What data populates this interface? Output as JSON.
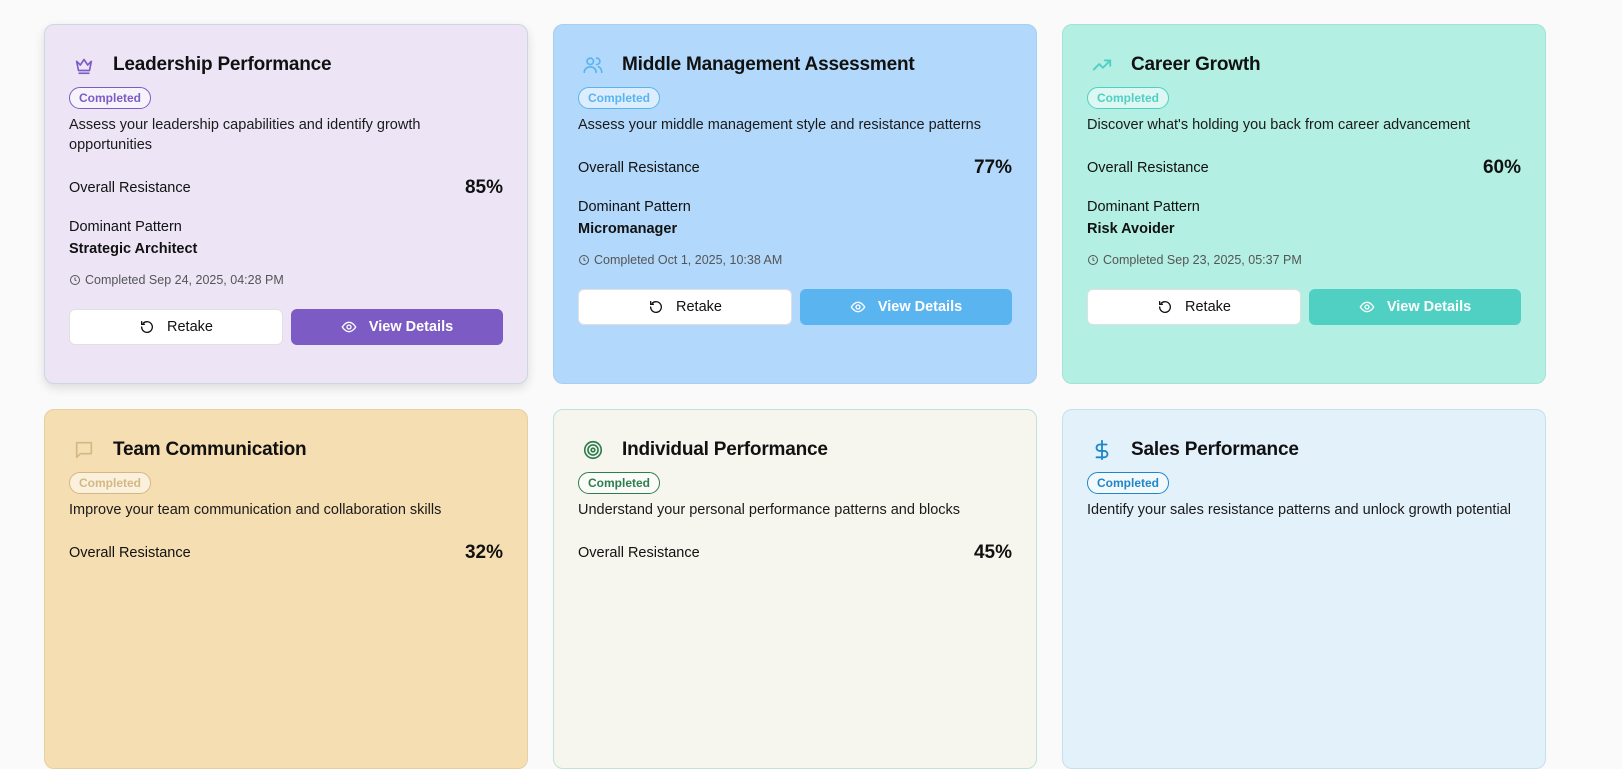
{
  "cards": [
    {
      "title": "Leadership Performance",
      "status": "Completed",
      "description": "Assess your leadership capabilities and identify growth opportunities",
      "resistance_label": "Overall Resistance",
      "resistance_value": "85%",
      "pattern_label": "Dominant Pattern",
      "pattern_value": "Strategic Architect",
      "completed_text": "Completed Sep 24, 2025, 04:28 PM",
      "retake_label": "Retake",
      "view_label": "View Details",
      "icon": "crown-icon",
      "colors": {
        "bg": "#ede5f6",
        "accent": "#7c5cc4",
        "border": "#ccd8df"
      }
    },
    {
      "title": "Middle Management Assessment",
      "status": "Completed",
      "description": "Assess your middle management style and resistance patterns",
      "resistance_label": "Overall Resistance",
      "resistance_value": "77%",
      "pattern_label": "Dominant Pattern",
      "pattern_value": "Micromanager",
      "completed_text": "Completed Oct 1, 2025, 10:38 AM",
      "retake_label": "Retake",
      "view_label": "View Details",
      "icon": "users-icon",
      "colors": {
        "bg": "#b2d8fb",
        "accent": "#5ab4f0",
        "border": "#a8cfee"
      }
    },
    {
      "title": "Career Growth",
      "status": "Completed",
      "description": "Discover what's holding you back from career advancement",
      "resistance_label": "Overall Resistance",
      "resistance_value": "60%",
      "pattern_label": "Dominant Pattern",
      "pattern_value": "Risk Avoider",
      "completed_text": "Completed Sep 23, 2025, 05:37 PM",
      "retake_label": "Retake",
      "view_label": "View Details",
      "icon": "trending-up-icon",
      "colors": {
        "bg": "#b3efe2",
        "accent": "#4fd0c2",
        "border": "#a4e2d6"
      }
    },
    {
      "title": "Team Communication",
      "status": "Completed",
      "description": "Improve your team communication and collaboration skills",
      "resistance_label": "Overall Resistance",
      "resistance_value": "32%",
      "icon": "message-icon",
      "colors": {
        "bg": "#f5deb1",
        "accent": "#d4b884",
        "border": "#e6cfa3"
      }
    },
    {
      "title": "Individual Performance",
      "status": "Completed",
      "description": "Understand your personal performance patterns and blocks",
      "resistance_label": "Overall Resistance",
      "resistance_value": "45%",
      "icon": "target-icon",
      "colors": {
        "bg": "#f6f6ee",
        "accent": "#2e7d4f",
        "border": "#bfe3d8"
      }
    },
    {
      "title": "Sales Performance",
      "status": "Completed",
      "description": "Identify your sales resistance patterns and unlock growth potential",
      "icon": "dollar-icon",
      "colors": {
        "bg": "#e3f1fb",
        "accent": "#1f87c9",
        "border": "#c4e1ec"
      }
    }
  ]
}
